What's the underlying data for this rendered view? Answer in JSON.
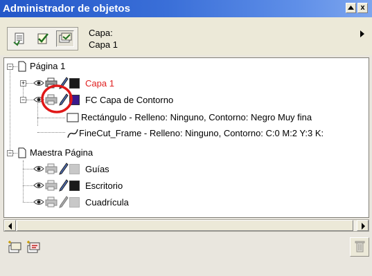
{
  "window": {
    "title": "Administrador de objetos",
    "menu_button_label": "▲x",
    "close_label": "x"
  },
  "header": {
    "layer_caption_label": "Capa:",
    "layer_caption_value": "Capa 1",
    "mode_buttons": [
      "show-object-properties-icon",
      "edit-across-layers-icon",
      "layer-manager-view-icon"
    ]
  },
  "tree": {
    "page1_label": "Página 1",
    "layer1": {
      "label": "Capa 1",
      "label_color": "#e02020",
      "color": "#1a1a1a"
    },
    "layer_fc": {
      "label": "FC Capa de Contorno",
      "color": "#3a1a8c"
    },
    "obj_rect_label": "Rectángulo - Relleno: Ninguno, Contorno: Negro Muy fina",
    "obj_frame_label": "FineCut_Frame - Relleno: Ninguno, Contorno: C:0 M:2 Y:3 K:",
    "master_label": "Maestra Página",
    "guides": {
      "label": "Guías",
      "color": "#c8c8c8"
    },
    "desktop": {
      "label": "Escritorio",
      "color": "#1a1a1a"
    },
    "grid": {
      "label": "Cuadrícula",
      "color": "#c8c8c8"
    }
  },
  "colors": {
    "highlight_circle": "#e01818",
    "title_bg": "#2f63d2"
  }
}
